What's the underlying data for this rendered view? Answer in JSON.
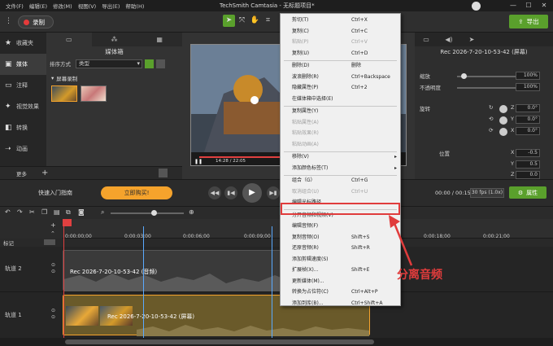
{
  "titlebar": {
    "menus": [
      "文件(F)",
      "编辑(E)",
      "修改(M)",
      "视图(V)",
      "导出(E)",
      "帮助(H)"
    ],
    "title": "TechSmith Camtasia - 无标题项目*",
    "minimize": "—",
    "maximize": "☐",
    "close": "✕"
  },
  "toolbar": {
    "record_label": "录制",
    "export_label": "导出",
    "accent": "#5aa02c"
  },
  "sidebar": {
    "items": [
      {
        "icon": "star-icon",
        "label": "收藏夹"
      },
      {
        "icon": "film-icon",
        "label": "媒体"
      },
      {
        "icon": "annotation-icon",
        "label": "注释"
      },
      {
        "icon": "wand-icon",
        "label": "视觉效果"
      },
      {
        "icon": "transition-icon",
        "label": "转换"
      },
      {
        "icon": "animation-icon",
        "label": "动画"
      }
    ],
    "more_label": "更多",
    "add_label": "+"
  },
  "media": {
    "title": "媒体箱",
    "sort_label": "排序方式",
    "sort_value": "类型",
    "group_label": "屏幕录制"
  },
  "preview": {
    "time": "14:28 / 22:05"
  },
  "properties": {
    "clip_title": "Rec 2026-7-20-10-53-42 (屏幕)",
    "scale_label": "缩放",
    "scale_value": "100%",
    "opacity_label": "不透明度",
    "opacity_value": "100%",
    "rotation_label": "旋转",
    "rot_z": "0.0°",
    "rot_y": "0.0°",
    "rot_x": "0.0°",
    "position_label": "位置",
    "pos_x": "-0.5",
    "pos_y": "0.5",
    "pos_z": "0.0",
    "axis_z": "Z",
    "axis_y": "Y",
    "axis_x": "X",
    "props_button": "属性"
  },
  "controls": {
    "guide_label": "快速入门指南",
    "buy_label": "立即购买!",
    "time_display": "00:00 / 00:15",
    "fps": "30 fps (1.0x)"
  },
  "timeline": {
    "ticks": [
      "0:00:00;00",
      "0:00:03;00",
      "0:00:06;00",
      "0:00:09;00",
      "0:00:18;00",
      "0:00:21;00"
    ],
    "marker_label": "标记",
    "track2_label": "轨道 2",
    "track1_label": "轨道 1",
    "audio_clip": "Rec 2026-7-20-10-53-42 (音频)",
    "screen_clip": "Rec 2026-7-20-10-53-42 (屏幕)"
  },
  "context_menu": {
    "items": [
      {
        "label": "剪切(T)",
        "shortcut": "Ctrl+X",
        "disabled": false
      },
      {
        "label": "复制(C)",
        "shortcut": "Ctrl+C",
        "disabled": false
      },
      {
        "label": "粘贴(P)",
        "shortcut": "Ctrl+V",
        "disabled": true
      },
      {
        "label": "复制(U)",
        "shortcut": "Ctrl+D",
        "disabled": false
      },
      {
        "label": "删除(D)",
        "shortcut": "删除",
        "disabled": false
      },
      {
        "label": "波浪删除(R)",
        "shortcut": "Ctrl+Backspace",
        "disabled": false
      },
      {
        "label": "隐藏属性(P)",
        "shortcut": "Ctrl+2",
        "disabled": false
      },
      {
        "label": "在媒体箱中选择(E)",
        "shortcut": "",
        "disabled": false
      },
      {
        "label": "复制属性(Y)",
        "shortcut": "",
        "disabled": false
      },
      {
        "label": "粘贴属性(A)",
        "shortcut": "",
        "disabled": true
      },
      {
        "label": "粘贴效果(R)",
        "shortcut": "",
        "disabled": true
      },
      {
        "label": "粘贴动画(A)",
        "shortcut": "",
        "disabled": true
      },
      {
        "label": "移除(V)",
        "shortcut": "",
        "disabled": false,
        "submenu": true
      },
      {
        "label": "添加颜色标签(T)",
        "shortcut": "",
        "disabled": false,
        "submenu": true
      },
      {
        "label": "组合（G）",
        "shortcut": "Ctrl+G",
        "disabled": false
      },
      {
        "label": "取消组合(U)",
        "shortcut": "Ctrl+U",
        "disabled": true
      },
      {
        "label": "编辑光标路径",
        "shortcut": "",
        "disabled": false
      },
      {
        "label": "分开音频和视频(V)",
        "shortcut": "",
        "disabled": false
      },
      {
        "label": "编辑音频(F)",
        "shortcut": "",
        "disabled": false
      },
      {
        "label": "复制音频(O)",
        "shortcut": "Shift+S",
        "disabled": false
      },
      {
        "label": "还原音频(R)",
        "shortcut": "Shift+R",
        "disabled": false
      },
      {
        "label": "添加剪辑速度(S)",
        "shortcut": "",
        "disabled": false
      },
      {
        "label": "扩展帧(X)...",
        "shortcut": "Shift+E",
        "disabled": false
      },
      {
        "label": "更新媒体(M)...",
        "shortcut": "",
        "disabled": false
      },
      {
        "label": "转换为占位符(C)",
        "shortcut": "Ctrl+Alt+P",
        "disabled": false
      },
      {
        "label": "添加到库(B)...",
        "shortcut": "Ctrl+Shift+A",
        "disabled": false
      }
    ]
  },
  "annotation": {
    "callout": "分离音频",
    "color": "#e03c3c"
  }
}
